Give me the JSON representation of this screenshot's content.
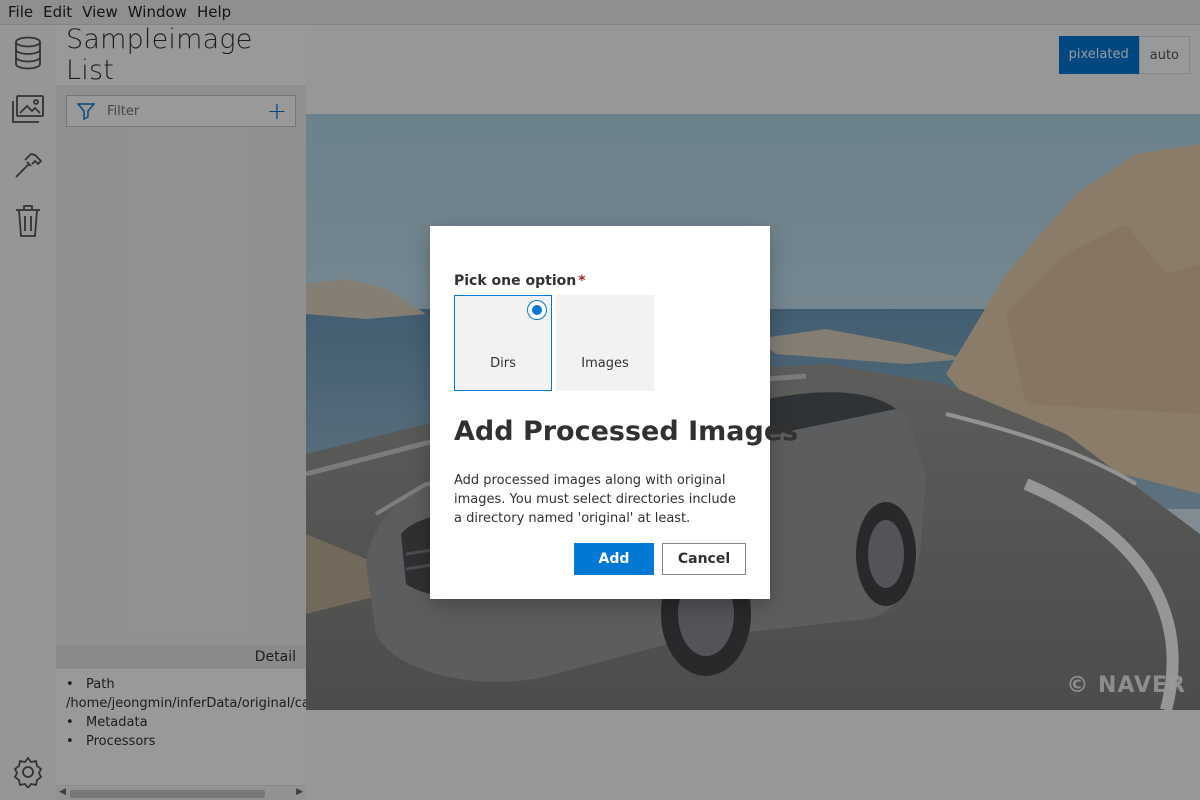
{
  "menu": {
    "items": [
      "File",
      "Edit",
      "View",
      "Window",
      "Help"
    ]
  },
  "rail": {
    "icons": [
      "database-icon",
      "images-icon",
      "hammer-icon",
      "trash-icon",
      "gear-icon"
    ]
  },
  "sidebar": {
    "title": "Sampleimage List",
    "filter_placeholder": "Filter",
    "detail_label": "Detail",
    "detail": {
      "path_label": "Path",
      "path_value": "/home/jeongmin/inferData/original/car",
      "metadata_label": "Metadata",
      "processors_label": "Processors"
    }
  },
  "main": {
    "render_modes": [
      "pixelated",
      "auto"
    ],
    "active_mode": "pixelated",
    "watermark": "© NAVER"
  },
  "dialog": {
    "pick_label": "Pick one option",
    "required_mark": "*",
    "options": [
      "Dirs",
      "Images"
    ],
    "selected_option": "Dirs",
    "title": "Add Processed Images",
    "description": "Add processed images along with original images. You must select directories include a directory named 'original' at least.",
    "add_label": "Add",
    "cancel_label": "Cancel"
  },
  "colors": {
    "accent": "#0078d4",
    "overlay": "rgba(0,0,0,0.4)"
  }
}
